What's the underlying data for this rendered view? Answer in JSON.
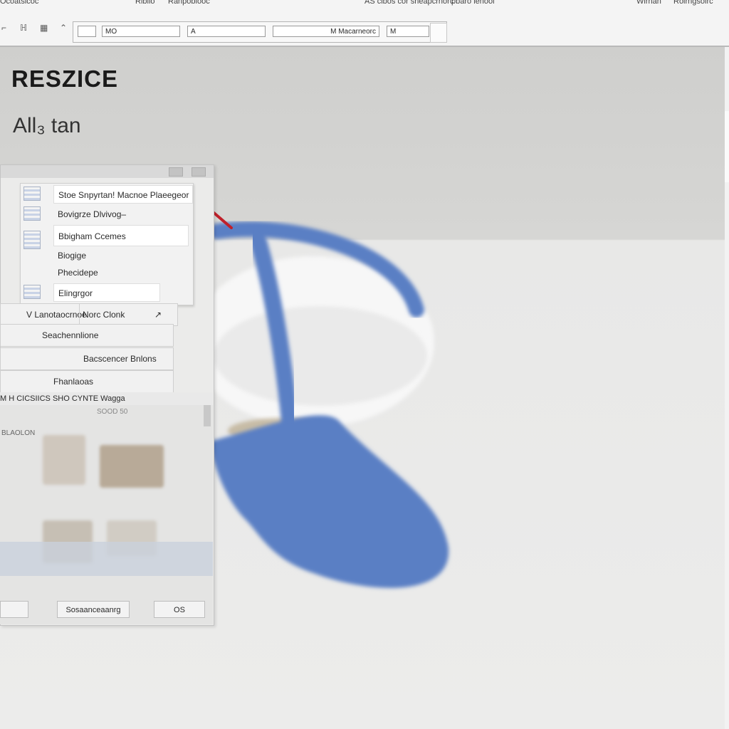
{
  "menu": {
    "items": [
      "Ocoatsicoc",
      "Riblio",
      "Ranpoblooc",
      "AS cibos cor sneapcrnorc",
      "pbaro ienooi",
      "Wirnan",
      "Roirngsoirc"
    ]
  },
  "toolbar": {
    "formula_cells": [
      "MO",
      "A",
      "M Macarneorc",
      "M"
    ]
  },
  "document": {
    "heading": "RESZICE",
    "subheading": "All₃ tan"
  },
  "panel": {
    "dropdown_items": [
      "Stoe Snpyrtan! Macnoe Plaeegeor",
      "Bovigrze Dlvivog–",
      "Bbigham Ccemes",
      "Biogige",
      "Phecidepe",
      "Elingrgor"
    ],
    "section_rows": [
      "V Lanotaocrnoe",
      "Norc Clonk",
      "Seachennlione",
      "Bacscencer Bnlons",
      "Fhanlaoas"
    ],
    "thumbs_title": "M H CICSIICS SHO CYNTE Wagga",
    "thumbs_caption": "SOOD 50",
    "thumbs_side_label": "BLAOLON",
    "bottom_buttons": [
      "Sosaanceaanrg",
      "OS"
    ]
  },
  "colors": {
    "accent_blue": "#5a7fc4",
    "arrow_red": "#c0202a"
  }
}
